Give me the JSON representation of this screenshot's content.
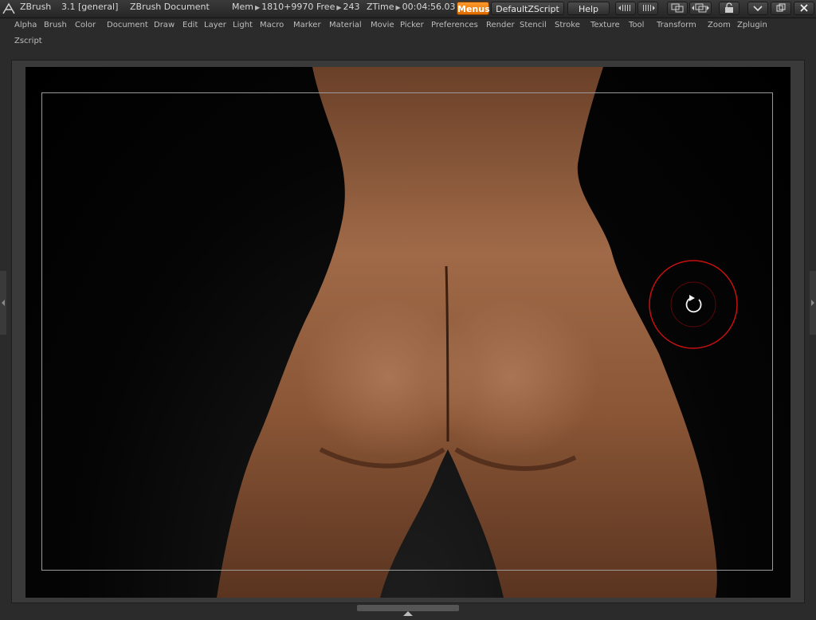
{
  "title_bar": {
    "app_name": "ZBrush",
    "version": "3.1 [general]",
    "document_name": "ZBrush Document",
    "mem_label": "Mem",
    "mem_value": "1810+9970",
    "free_label": "Free",
    "free_value": "243",
    "ztime_label": "ZTime",
    "ztime_value": "00:04:56.03"
  },
  "toolbar": {
    "menus_label": "Menus",
    "script_label": "DefaultZScript",
    "help_label": "Help"
  },
  "menu": {
    "items": [
      "Alpha",
      "Brush",
      "Color",
      "Document",
      "Draw",
      "Edit",
      "Layer",
      "Light",
      "Macro",
      "Marker",
      "Material",
      "Movie",
      "Picker",
      "Preferences",
      "Render",
      "Stencil",
      "Stroke",
      "Texture",
      "Tool",
      "Transform",
      "Zoom",
      "Zplugin",
      "Zscript"
    ]
  },
  "colors": {
    "accent": "#f07a00",
    "cursor_ring": "#c81010"
  },
  "icons": {
    "logo": "zbrush-logo-icon",
    "rotate": "rotate-icon"
  }
}
